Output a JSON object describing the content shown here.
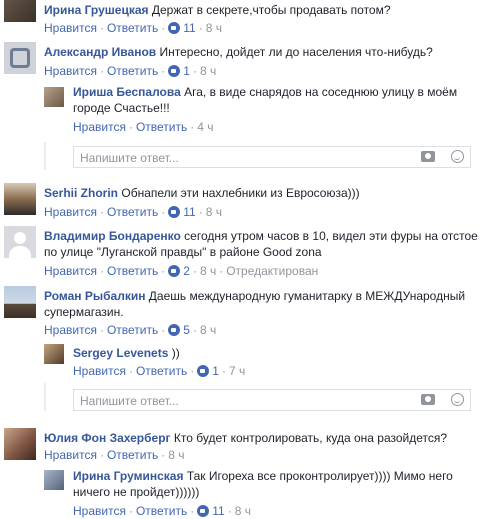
{
  "ui": {
    "like": "Нравится",
    "reply": "Ответить",
    "sep": "·",
    "reply_placeholder": "Напишите ответ..."
  },
  "comments": [
    {
      "name": "Ирина Грушецкая",
      "text": "Держат в секрете,чтобы продавать потом?",
      "likes": "11",
      "time": "8 ч"
    },
    {
      "name": "Александр Иванов",
      "text": "Интересно, дойдет ли до населения что-нибудь?",
      "likes": "1",
      "time": "8 ч",
      "replies": [
        {
          "name": "Ириша Беспалова",
          "text_line1": "Ага, в виде снарядов на соседнюю улицу в моём",
          "text_line2": "городе Счастье!!!",
          "time": "4 ч"
        }
      ]
    },
    {
      "name": "Serhii Zhorin",
      "text": "Обнапели эти нахлебники из Евросоюза)))",
      "likes": "11",
      "time": "8 ч"
    },
    {
      "name": "Владимир Бондаренко",
      "text_line1": "сегодня утром часов в 10, видел эти фуры на отстое",
      "text_line2": "по улице \"Луганской правды\" в районе Good zona",
      "likes": "2",
      "time": "8 ч",
      "edited": "Отредактирован"
    },
    {
      "name": "Роман Рыбалкин",
      "text_line1": "Даешь международную гуманитарку в МЕЖДУнародный",
      "text_line2": "супермагазин.",
      "likes": "5",
      "time": "8 ч",
      "replies": [
        {
          "name": "Sergey Levenets",
          "text": "))",
          "likes": "1",
          "time": "7 ч"
        }
      ]
    },
    {
      "name": "Юлия Фон Захерберг",
      "text": "Кто будет контролировать, куда она разойдется?",
      "time": "8 ч",
      "replies": [
        {
          "name": "Ирина Груминская",
          "text_line1": "Так Игореха все проконтролирует)))) Мимо него",
          "text_line2": "ничего не пройдет))))))",
          "likes": "11",
          "time": "8 ч"
        }
      ]
    }
  ],
  "colors": {
    "link": "#4267b2",
    "name": "#365899",
    "meta": "#90949c"
  }
}
